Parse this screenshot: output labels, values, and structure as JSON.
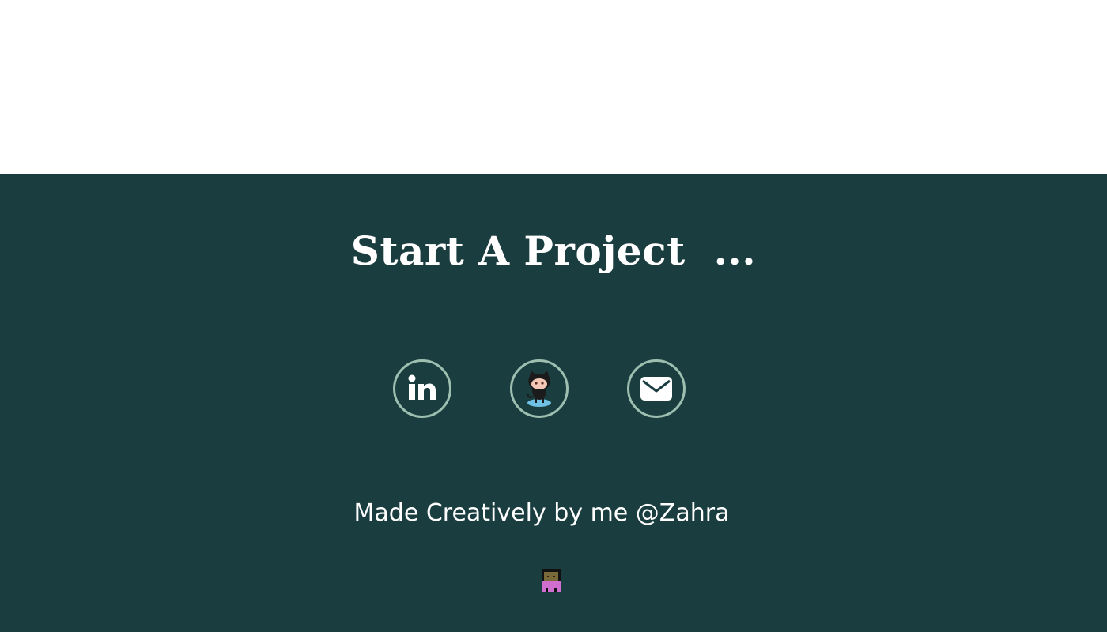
{
  "footer": {
    "cta_heading": "Start A Project  ...",
    "credit_text": "Made Creatively by me @Zahra",
    "background_color": "#1a3d3f",
    "ring_color": "#9cbfb0",
    "social_links": [
      {
        "name": "linkedin",
        "icon": "linkedin-icon"
      },
      {
        "name": "github",
        "icon": "github-octocat-icon"
      },
      {
        "name": "email",
        "icon": "envelope-icon"
      }
    ],
    "avatar_icon": "pixel-avatar-icon"
  }
}
